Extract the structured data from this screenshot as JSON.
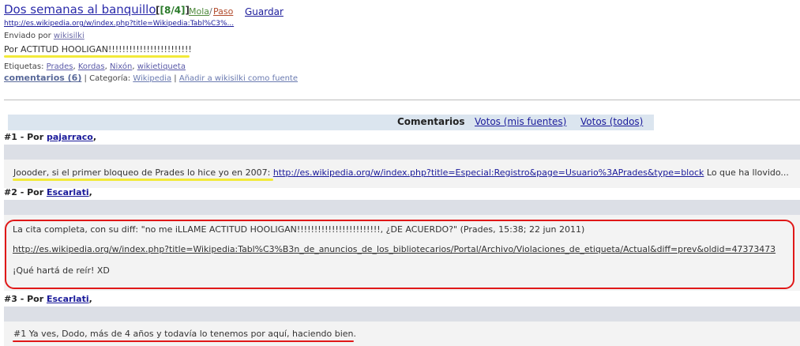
{
  "header": {
    "title": "Dos semanas al banquillo",
    "votes": "[8/4]",
    "mola": "Mola",
    "sep": "/",
    "paso": "Paso",
    "guardar": "Guardar",
    "url": "http://es.wikipedia.org/w/index.php?title=Wikipedia:Tabl%C3%...",
    "enviado_prefix": "Enviado por",
    "enviado_user": "wikisilki",
    "quote": "Por ACTITUD HOOLIGAN!!!!!!!!!!!!!!!!!!!!!!!!"
  },
  "meta": {
    "etiquetas_prefix": "Etiquetas:",
    "tags": [
      "Prades",
      "Kordas",
      "Nixón",
      "wikietiqueta"
    ],
    "comentarios": "comentarios (6)",
    "categoria_prefix": "| Categoría:",
    "categoria": "Wikipedia",
    "add_fuente": "Añadir a wikisilki como fuente",
    "bar": "|"
  },
  "tabs": {
    "active": "Comentarios",
    "votos_mis": "Votos (mis fuentes)",
    "votos_todos": "Votos (todos)"
  },
  "comments": [
    {
      "prefix": "#1 - Por",
      "user": "pajarraco",
      "text_before": "Joooder, si el primer bloqueo de Prades lo hice yo en 2007:",
      "link": "http://es.wikipedia.org/w/index.php?title=Especial:Registro&page=Usuario%3APrades&type=block",
      "text_after": "Lo que ha llovido..."
    },
    {
      "prefix": "#2 - Por",
      "user": "Escarlati",
      "line1": "La cita completa, con su diff: \"no me iLLAME ACTITUD HOOLIGAN!!!!!!!!!!!!!!!!!!!!!!!!, ¿DE ACUERDO?\" (Prades, 15:38; 22 jun 2011)",
      "link": "http://es.wikipedia.org/w/index.php?title=Wikipedia:Tabl%C3%B3n_de_anuncios_de_los_bibliotecarios/Portal/Archivo/Violaciones_de_etiqueta/Actual&diff=prev&oldid=47373473",
      "line3": "¡Qué hartá de reír! XD"
    },
    {
      "prefix": "#3 - Por",
      "user": "Escarlati",
      "text": "#1 Ya ves, Dodo, más de 4 años y todavía lo tenemos por aquí, haciendo bien."
    }
  ],
  "colors": {
    "highlight_yellow": "#f2ea3a",
    "annotation_red": "#e01818",
    "link": "#1a1a9a"
  }
}
